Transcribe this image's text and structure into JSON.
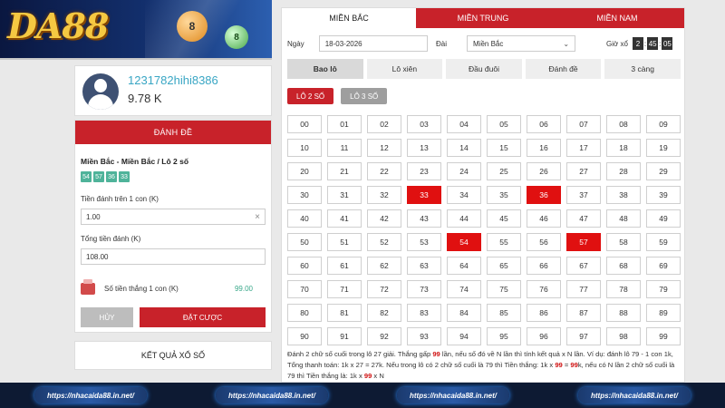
{
  "brand": {
    "logo_text": "DA88",
    "ball1": "8",
    "ball2": "8"
  },
  "user": {
    "username": "1231782hihi8386",
    "balance": "9.78 K"
  },
  "bet_panel": {
    "header": "ĐÁNH ĐỀ",
    "title": "Miền Bắc - Miền Bắc / Lô 2 số",
    "selected_numbers": [
      "54",
      "57",
      "36",
      "33"
    ],
    "per_unit_label": "Tiền đánh trên 1 con (K)",
    "per_unit_value": "1.00",
    "total_label": "Tổng tiền đánh (K)",
    "total_value": "108.00",
    "win_label": "Số tiền thắng 1 con (K)",
    "win_value": "99.00",
    "cancel_label": "HỦY",
    "submit_label": "ĐẶT CƯỢC"
  },
  "results_label": "KẾT QUẢ XỔ SỐ",
  "regions": [
    {
      "label": "MIỀN BẮC",
      "active": true
    },
    {
      "label": "MIỀN TRUNG",
      "active": false
    },
    {
      "label": "MIỀN NAM",
      "active": false
    }
  ],
  "filters": {
    "date_label": "Ngày",
    "date_value": "18-03-2026",
    "station_label": "Đài",
    "station_value": "Miền Bắc",
    "draw_label": "Giờ xổ",
    "draw_time": [
      "2",
      "45",
      "05"
    ]
  },
  "bet_types": [
    {
      "label": "Bao lô",
      "active": true
    },
    {
      "label": "Lô xiên",
      "active": false
    },
    {
      "label": "Đầu đuôi",
      "active": false
    },
    {
      "label": "Đánh đề",
      "active": false
    },
    {
      "label": "3 càng",
      "active": false
    }
  ],
  "sub_tabs": [
    {
      "label": "LÔ 2 SỐ",
      "active": true
    },
    {
      "label": "LÔ 3 SỐ",
      "active": false
    }
  ],
  "number_grid": {
    "numbers": [
      "00",
      "01",
      "02",
      "03",
      "04",
      "05",
      "06",
      "07",
      "08",
      "09",
      "10",
      "11",
      "12",
      "13",
      "14",
      "15",
      "16",
      "17",
      "18",
      "19",
      "20",
      "21",
      "22",
      "23",
      "24",
      "25",
      "26",
      "27",
      "28",
      "29",
      "30",
      "31",
      "32",
      "33",
      "34",
      "35",
      "36",
      "37",
      "38",
      "39",
      "40",
      "41",
      "42",
      "43",
      "44",
      "45",
      "46",
      "47",
      "48",
      "49",
      "50",
      "51",
      "52",
      "53",
      "54",
      "55",
      "56",
      "57",
      "58",
      "59",
      "60",
      "61",
      "62",
      "63",
      "64",
      "65",
      "66",
      "67",
      "68",
      "69",
      "70",
      "71",
      "72",
      "73",
      "74",
      "75",
      "76",
      "77",
      "78",
      "79",
      "80",
      "81",
      "82",
      "83",
      "84",
      "85",
      "86",
      "87",
      "88",
      "89",
      "90",
      "91",
      "92",
      "93",
      "94",
      "95",
      "96",
      "97",
      "98",
      "99"
    ],
    "selected": [
      "33",
      "36",
      "54",
      "57"
    ]
  },
  "note": {
    "p1": "Đánh 2 chữ số cuối trong lô 27 giải. Thắng gấp ",
    "h1": "99",
    "p2": " lần, nếu số đó về N lần thì tính kết quả x N lần. Ví dụ: đánh lô 79 - 1 con 1k, Tổng thanh toán: 1k x 27 = 27k. Nếu trong lô có 2 chữ số cuối là 79 thì Tiền thắng: 1k x ",
    "h2": "99",
    "p3": " = ",
    "h3": "99",
    "p4": "k, nếu có N lần 2 chữ số cuối là 79 thì Tiền thắng là: 1k x ",
    "h4": "99",
    "p5": " x N"
  },
  "footer_links": [
    "https://nhacaida88.in.net/",
    "https://nhacaida88.in.net/",
    "https://nhacaida88.in.net/",
    "https://nhacaida88.in.net/"
  ],
  "colors": {
    "accent": "#c8222a",
    "selected_cell": "#e01010",
    "chip": "#4fb39a",
    "username": "#39a6c4"
  }
}
